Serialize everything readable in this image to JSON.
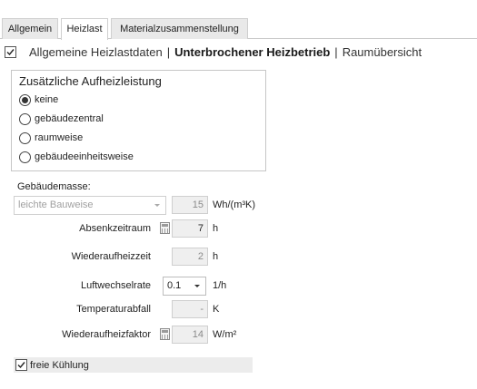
{
  "tabs": [
    {
      "label": "Allgemein",
      "active": false
    },
    {
      "label": "Heizlast",
      "active": true
    },
    {
      "label": "Materialzusammenstellung",
      "active": false
    }
  ],
  "subnav": {
    "checked": true,
    "items": [
      "Allgemeine Heizlastdaten",
      "Unterbrochener Heizbetrieb",
      "Raumübersicht"
    ],
    "active_item": "Unterbrochener Heizbetrieb",
    "separator": "|"
  },
  "zusatz": {
    "title": "Zusätzliche Aufheizleistung",
    "options": [
      "keine",
      "gebäudezentral",
      "raumweise",
      "gebäudeeinheitsweise"
    ],
    "selected": "keine"
  },
  "gebaeudemasse": {
    "label": "Gebäudemasse:",
    "combo_value": "leichte Bauweise",
    "value": "15",
    "unit": "Wh/(m³K)"
  },
  "absenkzeitraum": {
    "label": "Absenkzeitraum",
    "value": "7",
    "unit": "h"
  },
  "wiederaufheizzeit": {
    "label": "Wiederaufheizzeit",
    "value": "2",
    "unit": "h"
  },
  "luftwechselrate": {
    "label": "Luftwechselrate",
    "value": "0.1",
    "unit": "1/h"
  },
  "temperaturabfall": {
    "label": "Temperaturabfall",
    "value": "-",
    "unit": "K"
  },
  "wiederaufheizfaktor": {
    "label": "Wiederaufheizfaktor",
    "value": "14",
    "unit": "W/m²"
  },
  "freie_kuehlung": {
    "label": "freie Kühlung",
    "checked": true
  }
}
